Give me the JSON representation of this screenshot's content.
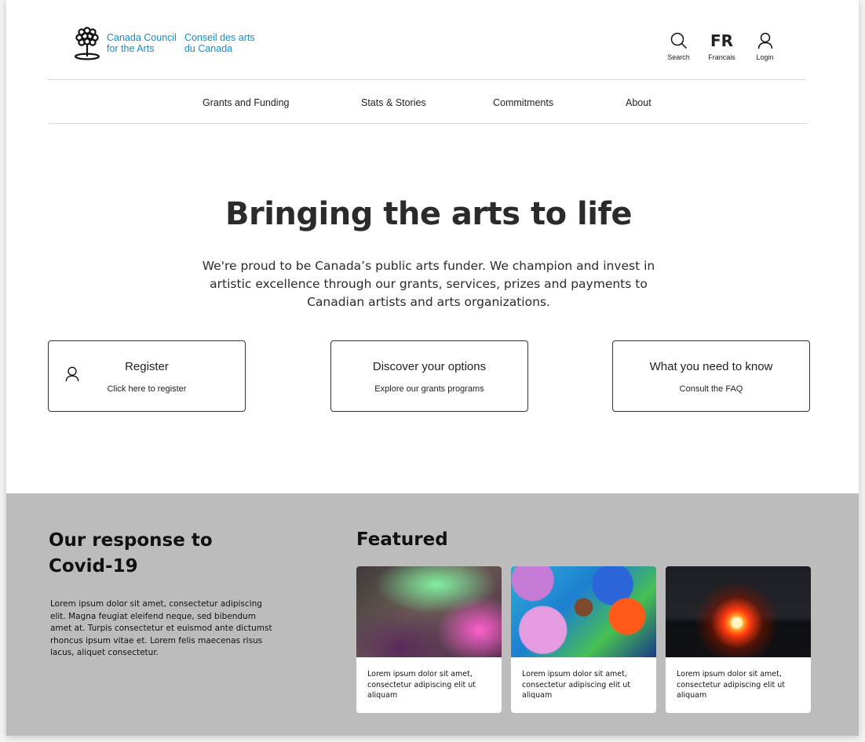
{
  "header": {
    "logo_en_line1": "Canada Council",
    "logo_en_line2": "for the Arts",
    "logo_fr_line1": "Conseil des arts",
    "logo_fr_line2": "du Canada",
    "search_label": "Search",
    "lang_short": "FR",
    "lang_label": "Francais",
    "login_label": "Login"
  },
  "nav": {
    "items": [
      "Grants and Funding",
      "Stats & Stories",
      "Commitments",
      "About"
    ]
  },
  "hero": {
    "title": "Bringing the arts to life",
    "description": "We're proud to be Canada’s public arts funder. We champion and invest in artistic excellence through our grants, services, prizes and payments to Canadian artists and arts organizations."
  },
  "cta": [
    {
      "title": "Register",
      "subtitle": "Click here to register",
      "icon": "person-icon"
    },
    {
      "title": "Discover your options",
      "subtitle": "Explore our grants programs"
    },
    {
      "title": "What you need to know",
      "subtitle": "Consult the FAQ"
    }
  ],
  "covid": {
    "title": "Our response to Covid-19",
    "text": "Lorem ipsum dolor sit amet, consectetur adipiscing elit. Magna feugiat eleifend neque, sed bibendum amet at. Turpis consectetur et euismod ante dictumst rhoncus ipsum vitae et. Lorem felis maecenas risus lacus, aliquet consectetur."
  },
  "featured": {
    "title": "Featured",
    "cards": [
      {
        "caption": "Lorem ipsum dolor sit amet, consectetur adipiscing elit ut aliquam",
        "image": "abstract-gradient-image"
      },
      {
        "caption": "Lorem ipsum dolor sit amet, consectetur adipiscing elit ut aliquam",
        "image": "butterfly-mural-image"
      },
      {
        "caption": "Lorem ipsum dolor sit amet, consectetur adipiscing elit ut aliquam",
        "image": "sunset-image"
      }
    ]
  },
  "colors": {
    "brand_blue": "#0e8fd0",
    "section_gray": "#bcbcbc",
    "text_dark": "#2b2b2b"
  }
}
